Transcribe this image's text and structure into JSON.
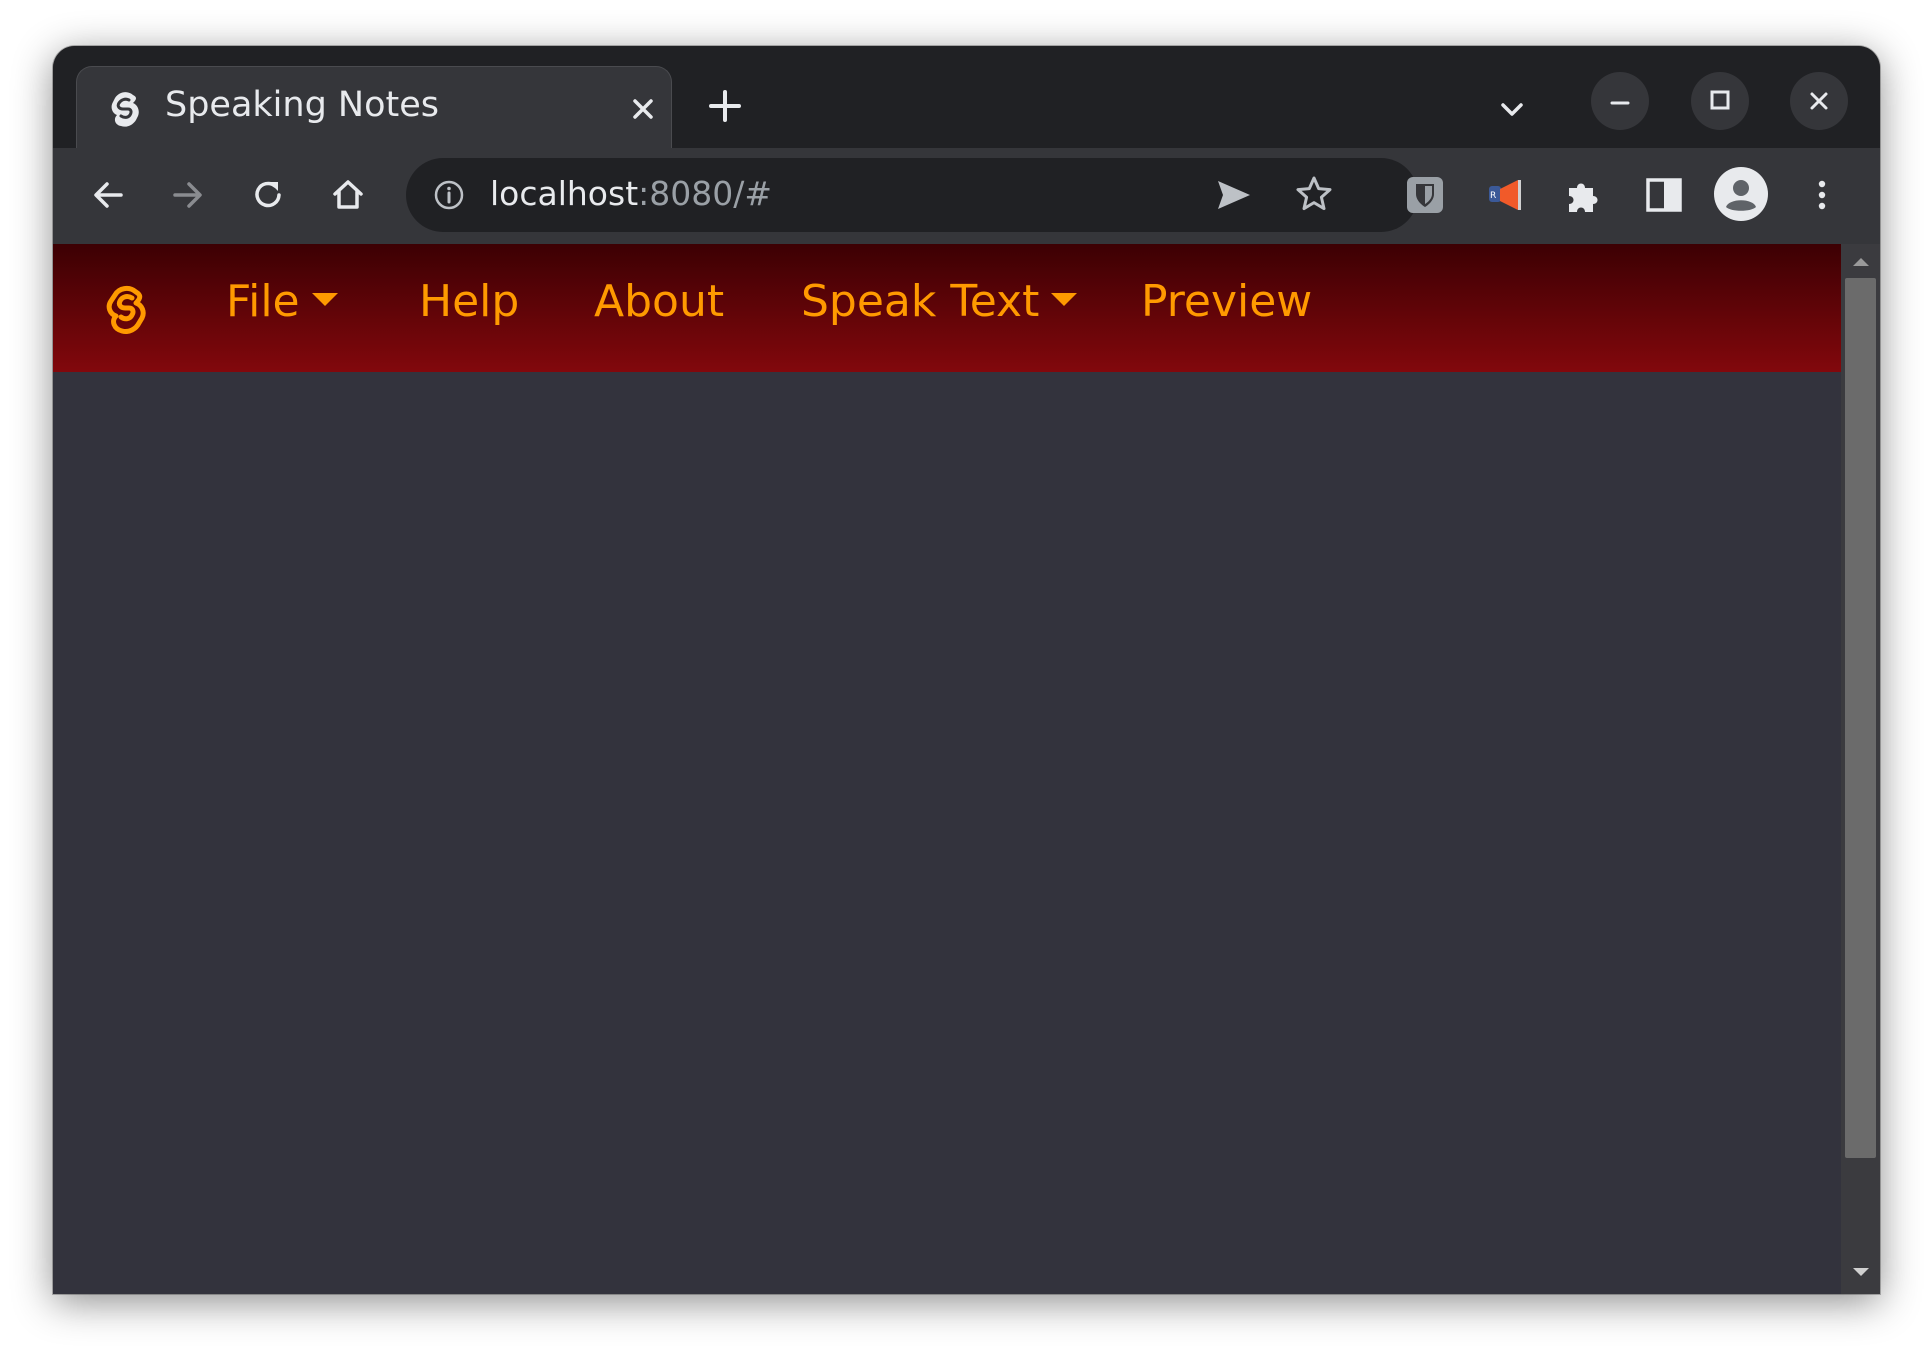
{
  "browser": {
    "tab": {
      "title": "Speaking Notes",
      "favicon": "svelte-logo-icon"
    },
    "address": {
      "host": "localhost",
      "rest": ":8080/#"
    },
    "colors": {
      "frame": "#202124",
      "toolbar": "#35363a",
      "text": "#e8eaed",
      "muted": "#9aa0a6"
    }
  },
  "app": {
    "logo": "svelte-logo-icon",
    "menu": [
      {
        "label": "File",
        "dropdown": true
      },
      {
        "label": "Help",
        "dropdown": false
      },
      {
        "label": "About",
        "dropdown": false
      },
      {
        "label": "Speak Text",
        "dropdown": true
      },
      {
        "label": "Preview",
        "dropdown": false
      }
    ],
    "colors": {
      "navbar_top": "#3c0003",
      "navbar_bottom": "#82080c",
      "accent": "#ff9a00",
      "content_bg": "#33333d"
    }
  }
}
